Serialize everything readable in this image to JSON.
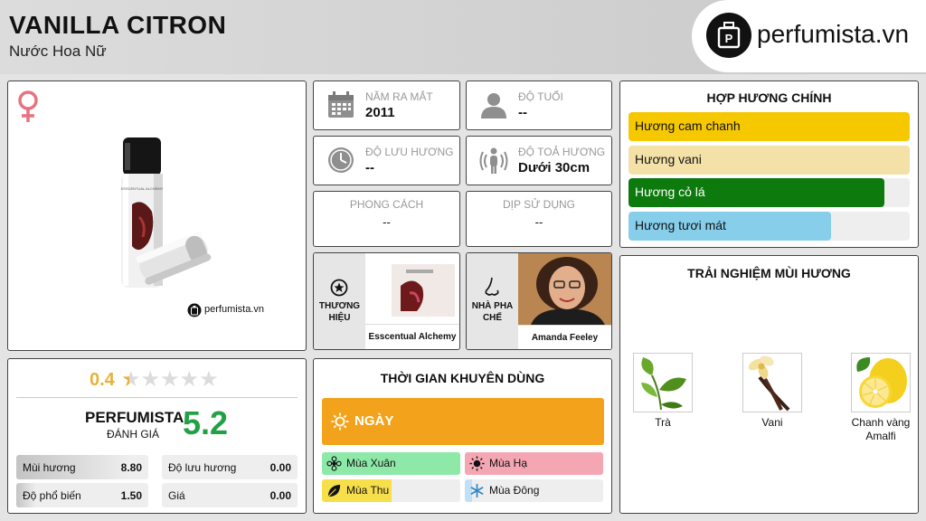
{
  "header": {
    "title": "VANILLA CITRON",
    "subtitle": "Nước Hoa Nữ",
    "logo_text": "perfumista.vn"
  },
  "product": {
    "gender_icon": "female-symbol-icon",
    "watermark": "perfumista.vn",
    "bottle_label": "ESSCENTUAL ALCHEMY"
  },
  "stats": {
    "launch": {
      "label": "NĂM RA MẮT",
      "value": "2011",
      "icon": "calendar-icon"
    },
    "age": {
      "label": "ĐỘ TUỔI",
      "value": "--",
      "icon": "person-icon"
    },
    "longevity": {
      "label": "ĐỘ LƯU HƯƠNG",
      "value": "--",
      "icon": "clock-icon"
    },
    "sillage": {
      "label": "ĐỘ TOẢ HƯƠNG",
      "value": "Dưới 30cm",
      "icon": "radiating-person-icon"
    },
    "style": {
      "label": "PHONG CÁCH",
      "value": "--"
    },
    "occasion": {
      "label": "DỊP SỬ DỤNG",
      "value": "--"
    }
  },
  "brand": {
    "label": "THƯƠNG HIỆU",
    "name": "Esscentual Alchemy",
    "icon": "star-badge-icon"
  },
  "perfumer": {
    "label": "NHÀ PHA CHẾ",
    "name": "Amanda Feeley",
    "icon": "nose-icon"
  },
  "accords": {
    "title": "HỢP HƯƠNG CHÍNH",
    "items": [
      {
        "label": "Hương cam chanh",
        "color": "#f5c800",
        "level": 1.0
      },
      {
        "label": "Hương vani",
        "color": "#f3e1a8",
        "level": 1.0
      },
      {
        "label": "Hương cỏ lá",
        "color": "#0d7a0d",
        "level": 0.91
      },
      {
        "label": "Hương tươi mát",
        "color": "#87ceeb",
        "level": 0.72
      }
    ]
  },
  "notes": {
    "title": "TRẢI NGHIỆM MÙI HƯƠNG",
    "items": [
      {
        "name": "Trà",
        "icon": "tea-leaves-icon"
      },
      {
        "name": "Vani",
        "icon": "vanilla-flower-icon"
      },
      {
        "name": "Chanh vàng Amalfi",
        "icon": "lemon-icon"
      }
    ]
  },
  "rating": {
    "score": "0.4",
    "stars_filled": 0.4,
    "stars_total": 5,
    "brand_label": "PERFUMISTA",
    "eval_label": "ĐÁNH GIÁ",
    "perfumista_score": "5.2",
    "metrics": [
      {
        "label": "Mùi hương",
        "value": "8.80",
        "level": 0.88
      },
      {
        "label": "Độ lưu hương",
        "value": "0.00",
        "level": 0.0
      },
      {
        "label": "Độ phổ biến",
        "value": "1.50",
        "level": 0.15
      },
      {
        "label": "Giá",
        "value": "0.00",
        "level": 0.0
      }
    ]
  },
  "time": {
    "title": "THỜI GIAN KHUYÊN DÙNG",
    "day_label": "NGÀY",
    "day_color": "#f2a31b",
    "seasons": [
      {
        "label": "Mùa Xuân",
        "color": "#8ee8a8",
        "level": 1.0,
        "icon": "spring-flower-icon"
      },
      {
        "label": "Mùa Hạ",
        "color": "#f4a6b2",
        "level": 1.0,
        "icon": "sun-icon"
      },
      {
        "label": "Mùa Thu",
        "color": "#f7df4b",
        "level": 0.5,
        "icon": "leaf-icon"
      },
      {
        "label": "Mùa Đông",
        "color": "#bfe0f5",
        "level": 0.05,
        "icon": "snowflake-icon"
      }
    ]
  }
}
